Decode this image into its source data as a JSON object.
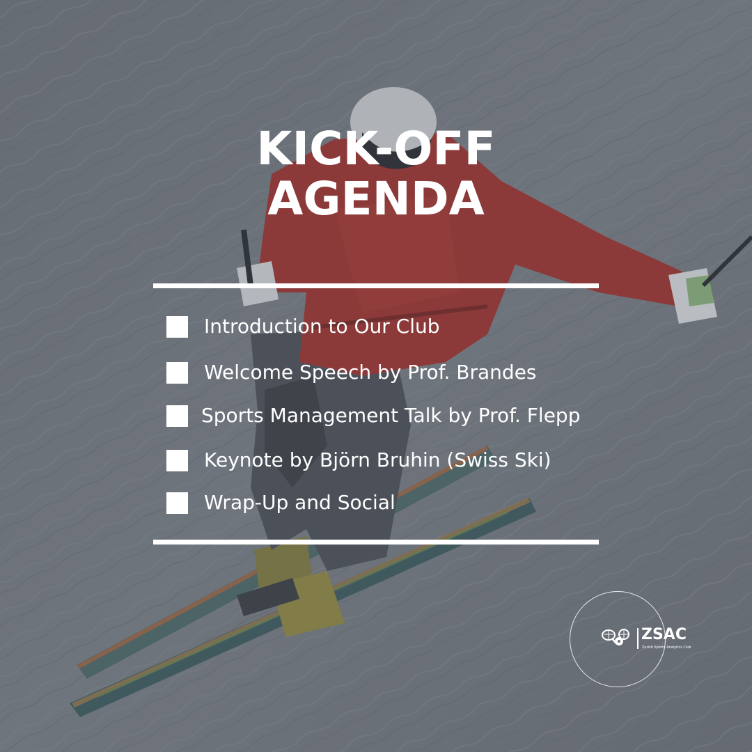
{
  "title": {
    "line1": "KICK-OFF",
    "line2": "AGENDA"
  },
  "agenda": {
    "items": [
      {
        "label": "Introduction to Our Club",
        "checked": false
      },
      {
        "label": "Welcome Speech by Prof. Brandes",
        "checked": false
      },
      {
        "label": "Sports Management Talk by Prof. Flepp",
        "checked": false
      },
      {
        "label": "Keynote by Björn Bruhin (Swiss Ski)",
        "checked": false
      },
      {
        "label": "Wrap-Up and Social",
        "checked": false
      }
    ]
  },
  "logo": {
    "name": "ZSAC",
    "subtitle": "Zurich Sports Analytics Club",
    "icons": [
      "tennis-racket-icon",
      "basketball-icon",
      "soccer-ball-icon"
    ]
  },
  "background": {
    "subject": "skier",
    "colors": {
      "snow": "#7d828a",
      "jacket": "#a8332f",
      "overlay": "#464b55"
    }
  },
  "colors": {
    "text": "#ffffff",
    "divider": "#ffffff",
    "checkbox": "#ffffff"
  }
}
